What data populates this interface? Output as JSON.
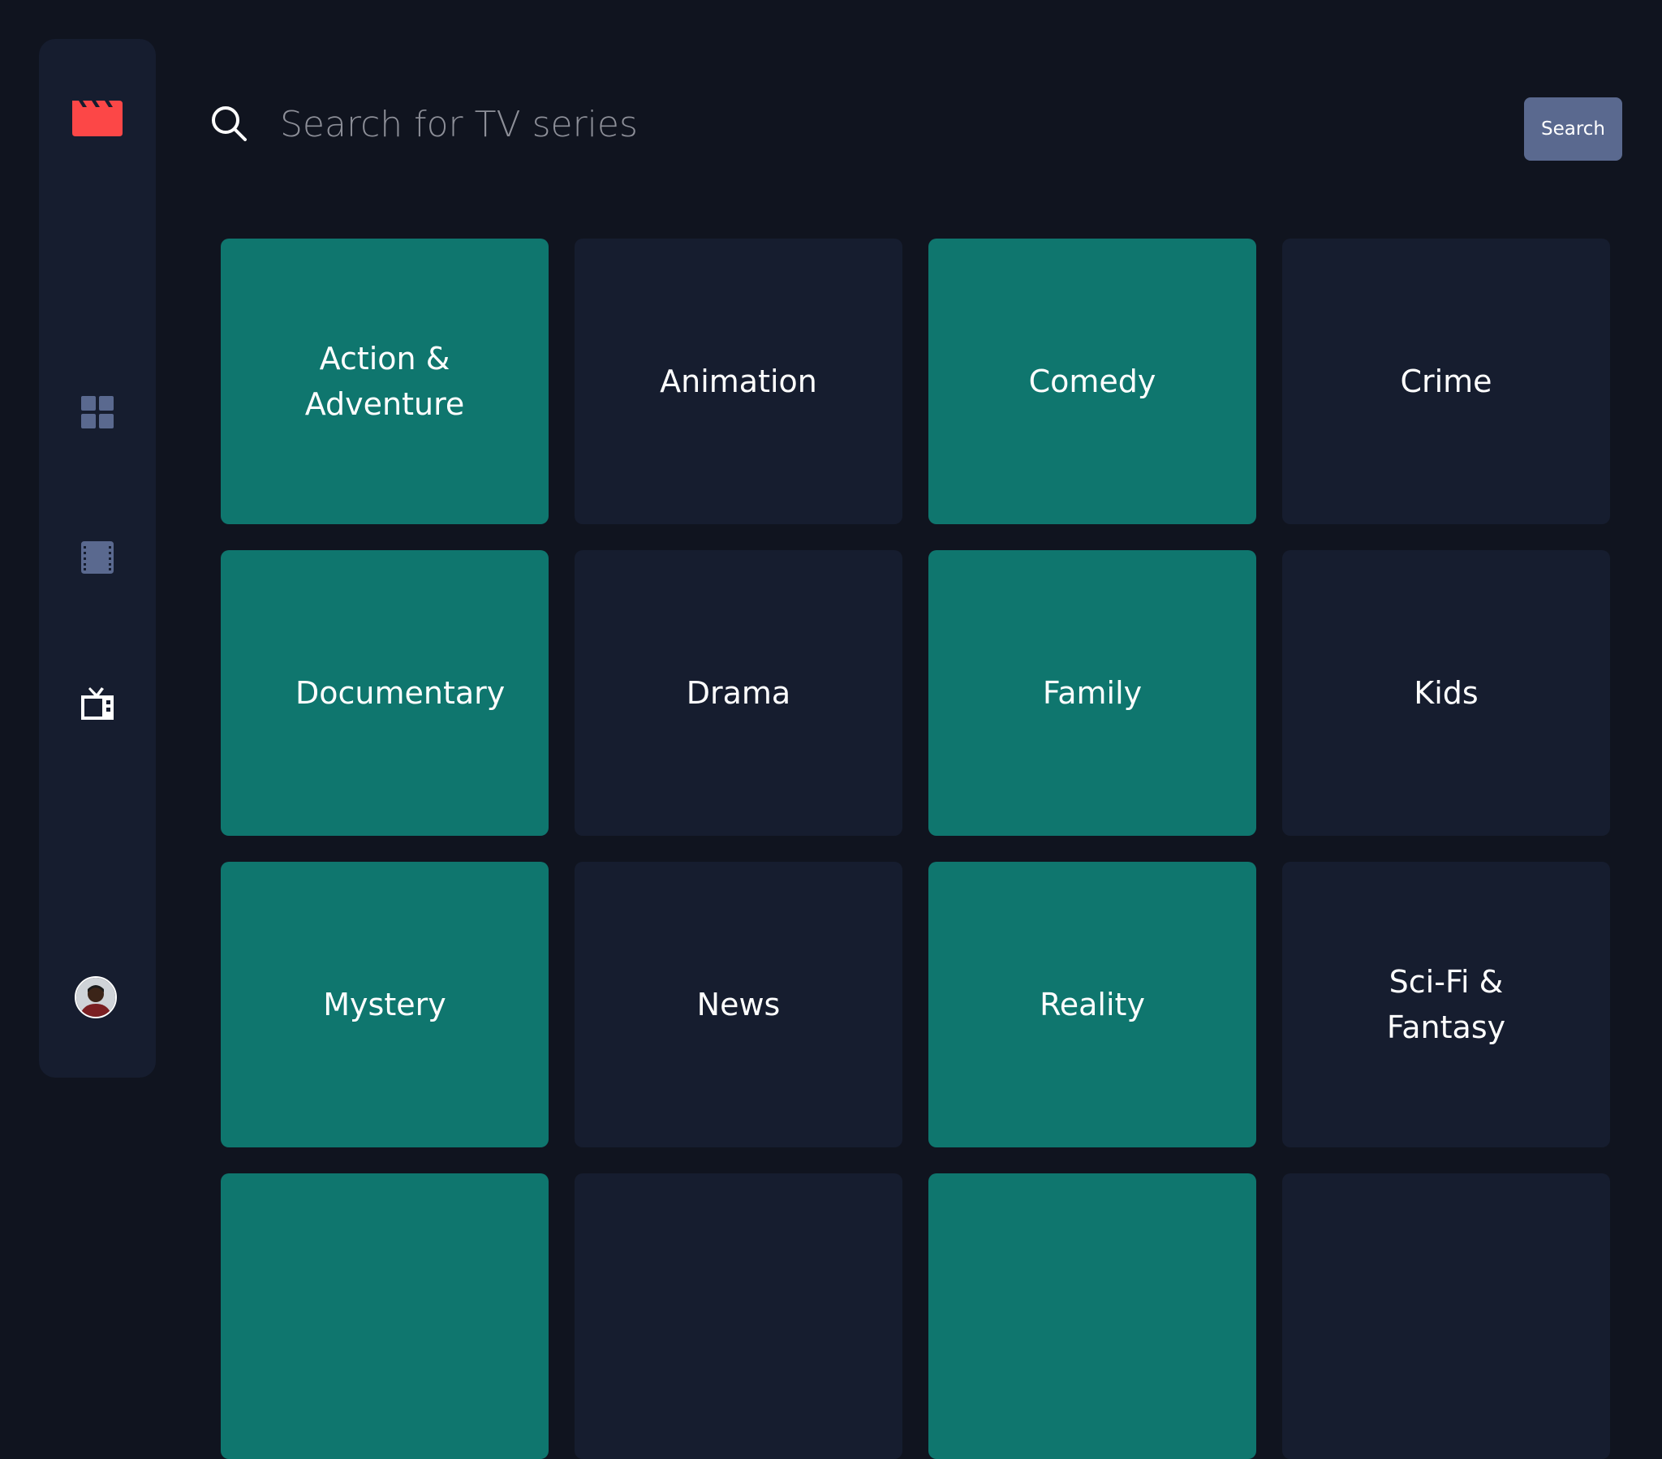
{
  "app": {
    "logo_icon": "clapperboard-icon",
    "accent_color": "#FC4747",
    "background_color": "#10141F",
    "surface_color": "#161D2F",
    "teal_color": "#0F766E"
  },
  "sidebar": {
    "nav": [
      {
        "name": "home",
        "icon": "grid-icon",
        "active": false
      },
      {
        "name": "movies",
        "icon": "film-icon",
        "active": false
      },
      {
        "name": "tv-series",
        "icon": "tv-icon",
        "active": true
      }
    ],
    "avatar_icon": "user-avatar"
  },
  "search": {
    "placeholder": "Search for TV series",
    "value": "",
    "button_label": "Search"
  },
  "genres": [
    {
      "label": "Action & Adventure",
      "style": "teal"
    },
    {
      "label": "Animation",
      "style": "dark"
    },
    {
      "label": "Comedy",
      "style": "teal"
    },
    {
      "label": "Crime",
      "style": "dark"
    },
    {
      "label": "Documentary",
      "style": "teal"
    },
    {
      "label": "Drama",
      "style": "dark"
    },
    {
      "label": "Family",
      "style": "teal"
    },
    {
      "label": "Kids",
      "style": "dark"
    },
    {
      "label": "Mystery",
      "style": "teal"
    },
    {
      "label": "News",
      "style": "dark"
    },
    {
      "label": "Reality",
      "style": "teal"
    },
    {
      "label": "Sci-Fi & Fantasy",
      "style": "dark"
    },
    {
      "label": "",
      "style": "teal"
    },
    {
      "label": "",
      "style": "dark"
    },
    {
      "label": "",
      "style": "teal"
    },
    {
      "label": "",
      "style": "dark"
    }
  ]
}
